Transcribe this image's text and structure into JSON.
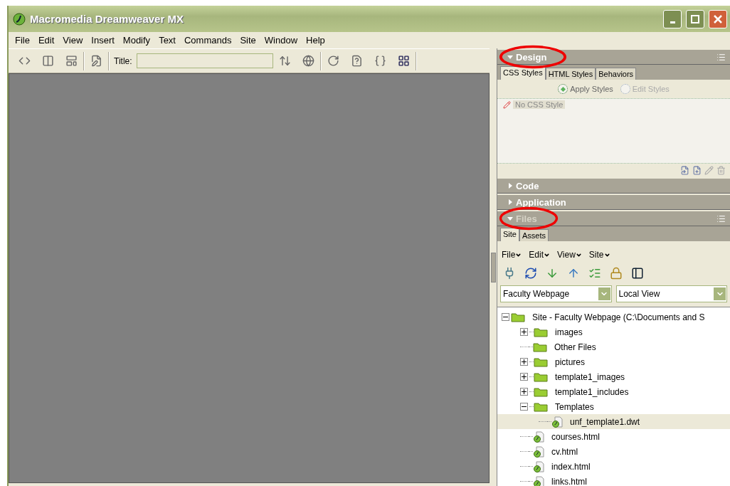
{
  "window": {
    "title": "Macromedia Dreamweaver MX"
  },
  "menu": [
    "File",
    "Edit",
    "View",
    "Insert",
    "Modify",
    "Text",
    "Commands",
    "Site",
    "Window",
    "Help"
  ],
  "toolbar": {
    "title_label": "Title:"
  },
  "panel_groups": [
    {
      "kind": "design",
      "title": "Design",
      "expanded": true,
      "highlighted": true,
      "tabs": [
        {
          "label": "CSS Styles",
          "selected": true
        },
        {
          "label": "HTML Styles",
          "selected": false
        },
        {
          "label": "Behaviors",
          "selected": false
        }
      ],
      "radios": [
        {
          "label": "Apply Styles",
          "selected": true
        },
        {
          "label": "Edit Styles",
          "selected": false
        }
      ],
      "styles": [
        "No CSS Style"
      ]
    },
    {
      "kind": "collapsed",
      "title": "Code",
      "expanded": false,
      "highlighted": false
    },
    {
      "kind": "collapsed",
      "title": "Application",
      "expanded": false,
      "highlighted": false
    },
    {
      "kind": "files",
      "title": "Files",
      "expanded": true,
      "highlighted": true,
      "tabs": [
        {
          "label": "Site",
          "selected": true
        },
        {
          "label": "Assets",
          "selected": false
        }
      ],
      "menu": [
        "File",
        "Edit",
        "View",
        "Site"
      ],
      "site_select": "Faculty Webpage",
      "view_select": "Local View",
      "tree": [
        {
          "label": "Site - Faculty Webpage (C:\\Documents and S",
          "kind": "folder",
          "expanded": true,
          "selected": false,
          "children": [
            {
              "label": "images",
              "kind": "folder",
              "expanded": false,
              "selected": false
            },
            {
              "label": "Other Files",
              "kind": "folder",
              "selected": false
            },
            {
              "label": "pictures",
              "kind": "folder",
              "expanded": false,
              "selected": false
            },
            {
              "label": "template1_images",
              "kind": "folder",
              "expanded": false,
              "selected": false
            },
            {
              "label": "template1_includes",
              "kind": "folder",
              "expanded": false,
              "selected": false
            },
            {
              "label": "Templates",
              "kind": "folder",
              "expanded": true,
              "selected": false,
              "children": [
                {
                  "label": "unf_template1.dwt",
                  "kind": "file",
                  "selected": true
                }
              ]
            },
            {
              "label": "courses.html",
              "kind": "file",
              "selected": false
            },
            {
              "label": "cv.html",
              "kind": "file",
              "selected": false
            },
            {
              "label": "index.html",
              "kind": "file",
              "selected": false
            },
            {
              "label": "links.html",
              "kind": "file",
              "selected": false
            }
          ]
        }
      ]
    }
  ]
}
